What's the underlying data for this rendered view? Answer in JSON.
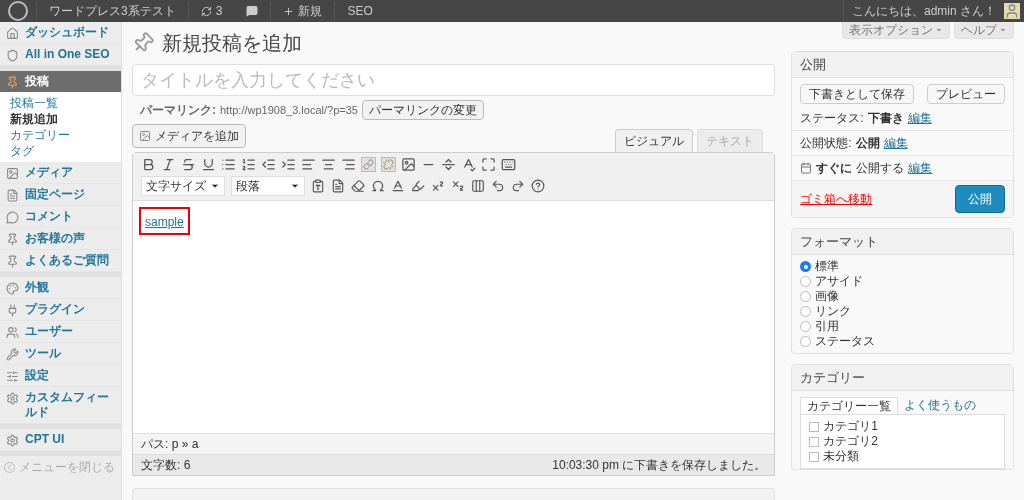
{
  "admin_bar": {
    "site": "ワードプレス3系テスト",
    "updates": "3",
    "new": "新規",
    "seo": "SEO",
    "greeting": "こんにちは、admin さん！"
  },
  "sidebar": {
    "groups": [
      [
        {
          "label": "ダッシュボード",
          "selected": false
        },
        {
          "label": "All in One SEO",
          "selected": false
        }
      ],
      [
        {
          "label": "投稿",
          "selected": true,
          "children": [
            {
              "label": "投稿一覧",
              "selected": false
            },
            {
              "label": "新規追加",
              "selected": true
            },
            {
              "label": "カテゴリー",
              "selected": false
            },
            {
              "label": "タグ",
              "selected": false
            }
          ]
        },
        {
          "label": "メディア",
          "selected": false
        },
        {
          "label": "固定ページ",
          "selected": false
        },
        {
          "label": "コメント",
          "selected": false
        },
        {
          "label": "お客様の声",
          "selected": false
        },
        {
          "label": "よくあるご質問",
          "selected": false
        }
      ],
      [
        {
          "label": "外観",
          "selected": false
        },
        {
          "label": "プラグイン",
          "selected": false
        },
        {
          "label": "ユーザー",
          "selected": false
        },
        {
          "label": "ツール",
          "selected": false
        },
        {
          "label": "設定",
          "selected": false
        },
        {
          "label": "カスタムフィールド",
          "selected": false
        }
      ],
      [
        {
          "label": "CPT UI",
          "selected": false
        }
      ]
    ],
    "collapse": "メニューを閉じる"
  },
  "screen_buttons": [
    "表示オプション",
    "ヘルプ"
  ],
  "page_title": "新規投稿を追加",
  "title_field": {
    "placeholder": "タイトルを入力してください"
  },
  "permalink": {
    "label": "パーマリンク:",
    "url": "http://wp1908_3.local/?p=35",
    "button": "パーマリンクの変更"
  },
  "add_media": "メディアを追加",
  "editor_tabs": [
    {
      "label": "ビジュアル",
      "selected": true
    },
    {
      "label": "テキスト",
      "selected": false
    }
  ],
  "toolbar": {
    "font_size": "文字サイズ",
    "paragraph": "段落"
  },
  "content_link": "sample",
  "path": "パス: p » a",
  "word_count": "文字数: 6",
  "autosave": "10:03:30 pm に下書きを保存しました。",
  "publish_box": {
    "title": "公開",
    "save_draft": "下書きとして保存",
    "preview": "プレビュー",
    "rows": [
      {
        "label": "ステータス:",
        "value": "下書き",
        "edit": "編集"
      },
      {
        "label": "公開状態:",
        "value": "公開",
        "edit": "編集"
      },
      {
        "label": "公開する",
        "value": "すぐに",
        "edit": "編集"
      }
    ],
    "trash": "ゴミ箱へ移動",
    "publish": "公開"
  },
  "format_box": {
    "title": "フォーマット",
    "options": [
      {
        "label": "標準",
        "selected": true
      },
      {
        "label": "アサイド",
        "selected": false
      },
      {
        "label": "画像",
        "selected": false
      },
      {
        "label": "リンク",
        "selected": false
      },
      {
        "label": "引用",
        "selected": false
      },
      {
        "label": "ステータス",
        "selected": false
      }
    ]
  },
  "category_box": {
    "title": "カテゴリー",
    "tabs": [
      {
        "label": "カテゴリー一覧",
        "selected": true
      },
      {
        "label": "よく使うもの",
        "selected": false
      }
    ],
    "items": [
      {
        "label": "カテゴリ1",
        "checked": false
      },
      {
        "label": "カテゴリ2",
        "checked": false
      },
      {
        "label": "未分類",
        "checked": false
      }
    ]
  }
}
